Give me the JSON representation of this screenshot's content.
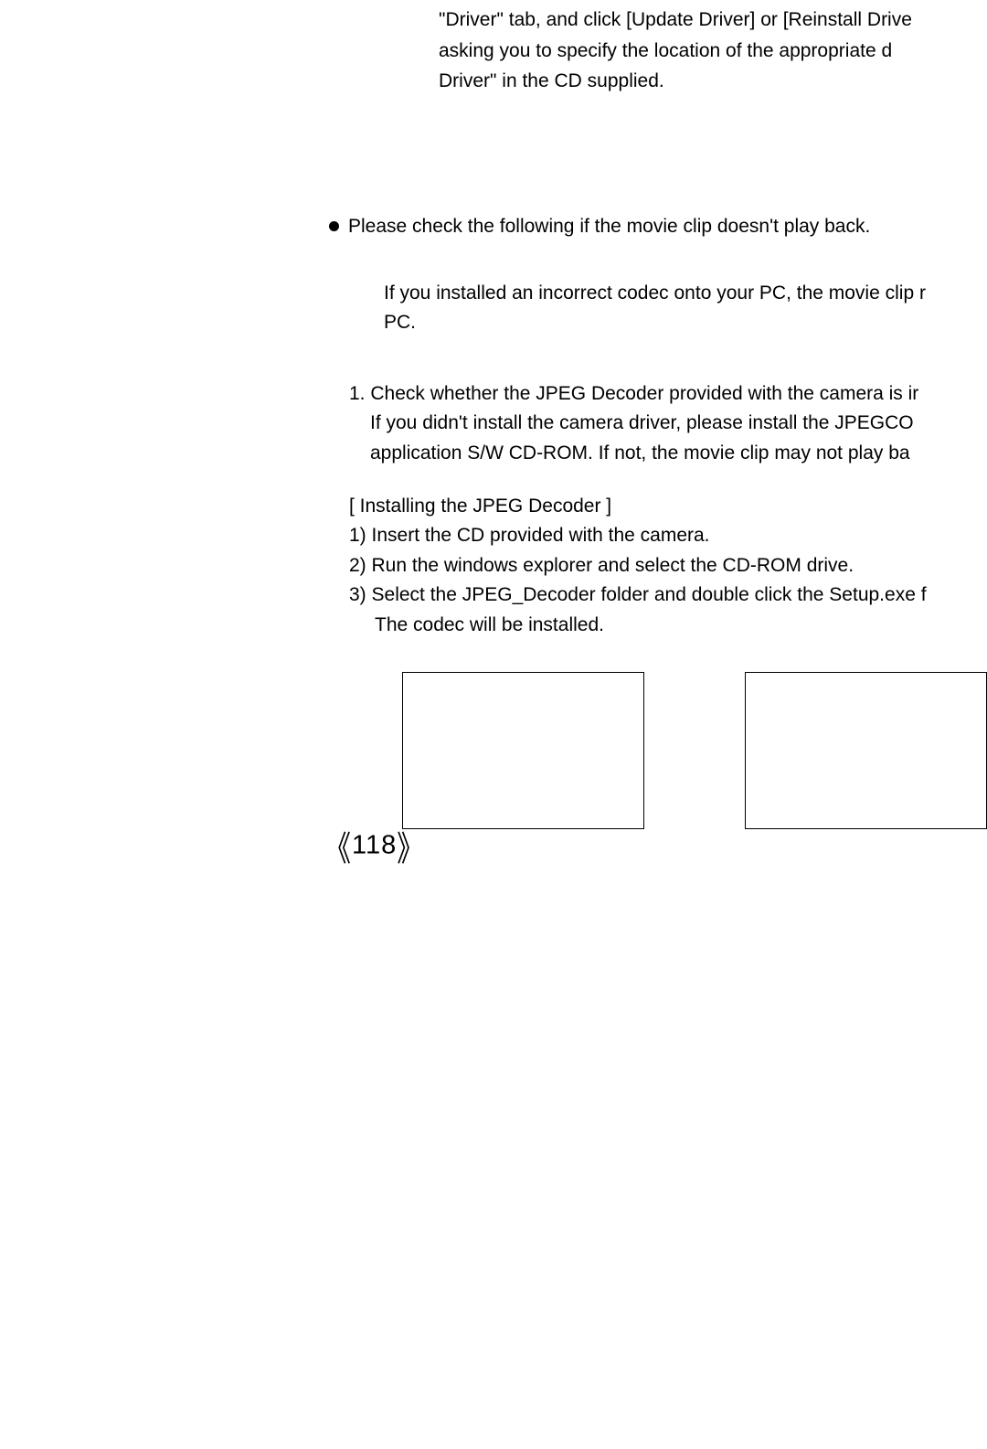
{
  "para1_line1": "\"Driver\" tab, and click [Update Driver] or [Reinstall Drive",
  "para1_line2": "asking you to specify the location of the appropriate d",
  "para1_line3": "Driver\" in the CD supplied.",
  "bullet_text": "Please check the following if the movie clip doesn't play back.",
  "indent1_line1": "If you installed an incorrect codec onto your PC, the movie clip r",
  "indent1_line2": "PC.",
  "item1_num": "1. Check whether the JPEG Decoder provided with the camera is ir",
  "item1_sub1": "If you didn't install the camera driver, please install the JPEGCO",
  "item1_sub2": "application S/W CD-ROM. If not, the movie clip may not play ba",
  "install_title": "[ Installing the JPEG Decoder ]",
  "install_1": "1) Insert the CD provided with the camera.",
  "install_2": "2) Run the windows explorer and select the CD-ROM drive.",
  "install_3": "3) Select the JPEG_Decoder folder and double click the Setup.exe f",
  "install_3b": "The codec will be installed.",
  "page_number": "118"
}
